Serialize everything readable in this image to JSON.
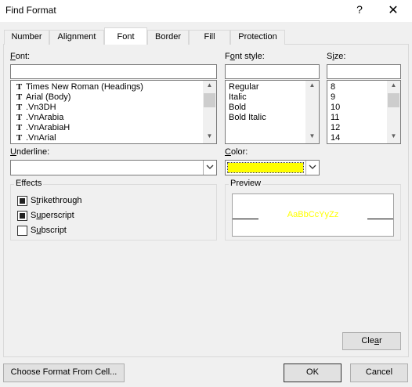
{
  "window": {
    "title": "Find Format",
    "help": "?",
    "close": "✕"
  },
  "tabs": [
    {
      "label": "Number"
    },
    {
      "label": "Alignment"
    },
    {
      "label": "Font"
    },
    {
      "label": "Border"
    },
    {
      "label": "Fill"
    },
    {
      "label": "Protection"
    }
  ],
  "active_tab": "Font",
  "font": {
    "label": "Font:",
    "value": "",
    "items": [
      "Times New Roman (Headings)",
      "Arial (Body)",
      ".Vn3DH",
      ".VnArabia",
      ".VnArabiaH",
      ".VnArial"
    ],
    "item_icon": "truetype-font-icon"
  },
  "font_style": {
    "label": "Font style:",
    "value": "",
    "items": [
      "Regular",
      "Italic",
      "Bold",
      "Bold Italic"
    ]
  },
  "size": {
    "label": "Size:",
    "value": "",
    "items": [
      "8",
      "9",
      "10",
      "11",
      "12",
      "14"
    ]
  },
  "underline": {
    "label": "Underline:",
    "value": ""
  },
  "color": {
    "label": "Color:",
    "swatch": "#ffff00"
  },
  "effects": {
    "title": "Effects",
    "items": [
      {
        "label": "Strikethrough",
        "checked": true
      },
      {
        "label": "Superscript",
        "checked": true
      },
      {
        "label": "Subscript",
        "checked": false
      }
    ]
  },
  "preview": {
    "title": "Preview",
    "sample": "AaBbCcYyZz",
    "color": "#ffff00"
  },
  "buttons": {
    "clear": "Clear",
    "choose_format": "Choose Format From Cell...",
    "ok": "OK",
    "cancel": "Cancel"
  }
}
